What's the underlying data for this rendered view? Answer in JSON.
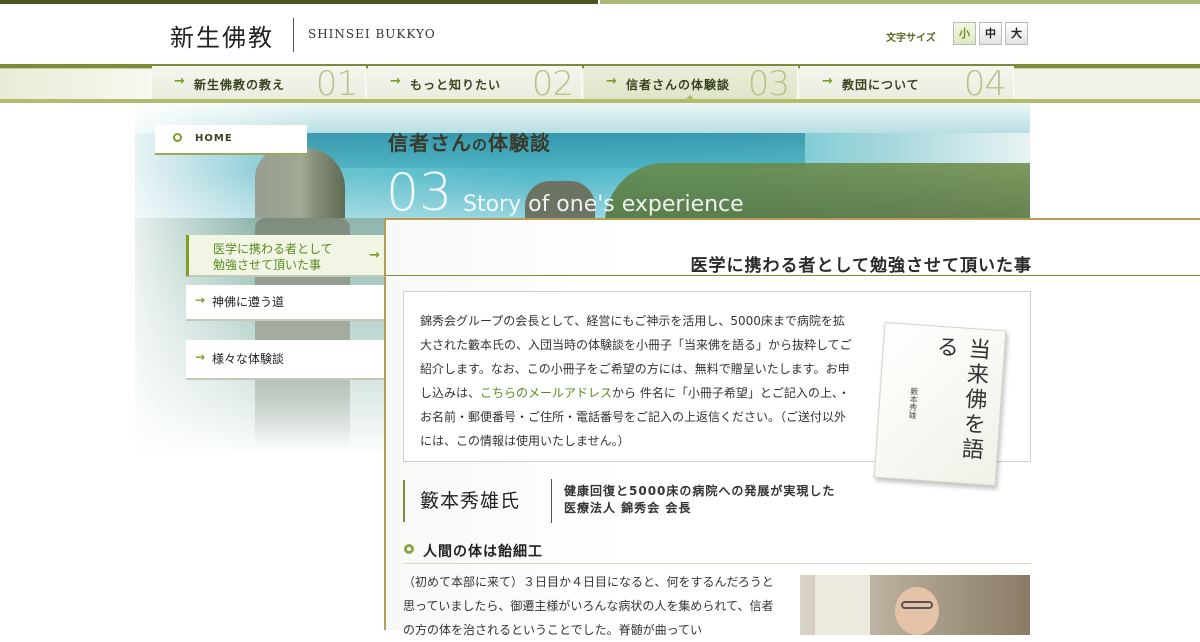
{
  "header": {
    "logo_jp": "新生佛教",
    "logo_en": "SHINSEI BUKKYO",
    "font_size_label": "文字サイズ",
    "font_sizes": [
      "小",
      "中",
      "大"
    ],
    "font_size_selected": "小"
  },
  "nav": {
    "items": [
      {
        "label": "新生佛教の教え",
        "num": "01"
      },
      {
        "label": "もっと知りたい",
        "num": "02"
      },
      {
        "label": "信者さんの体験談",
        "num": "03"
      },
      {
        "label": "教団について",
        "num": "04"
      }
    ],
    "current_index": 2
  },
  "hero": {
    "title_main": "信者さん",
    "title_particle": "の",
    "title_tail": "体験談",
    "num": "03",
    "subtitle_en": "Story of one's experience"
  },
  "sidebar": {
    "home_label": "HOME",
    "items": [
      {
        "label_line1": "医学に携わる者として",
        "label_line2": "勉強させて頂いた事",
        "active": true
      },
      {
        "label": "神佛に遵う道"
      },
      {
        "label": "様々な体験談"
      }
    ]
  },
  "article": {
    "title": "医学に携わる者として勉強させて頂いた事",
    "intro_1": "錦秀会グループの会長として、経営にもご神示を活用し、5000床まで病院を拡大された籔本氏の、入団当時の体験談を小冊子「当来佛を語る」から抜粋してご紹介します。なお、この小冊子をご希望の方には、無料で贈呈いたします。お申し込みは、",
    "intro_link": "こちらのメールアドレス",
    "intro_2": "から 件名に「小冊子希望」とご記入の上、・お名前・郵便番号・ご住所・電話番号をご記入の上返信ください。（ご送付以外には、この情報は使用いたしません。）",
    "book_title": "当来佛を語る",
    "book_author": "籔本秀雄",
    "person_name": "籔本秀雄氏",
    "person_desc_1": "健康回復と5000床の病院への発展が実現した",
    "person_desc_2": "医療法人 錦秀会 会長",
    "section_title": "人間の体は飴細工",
    "body": "（初めて本部に来て）３日目か４日目になると、何をするんだろうと思っていましたら、御遷主様がいろんな病状の人を集められて、信者の方の体を治されるということでした。脊髄が曲ってい"
  }
}
